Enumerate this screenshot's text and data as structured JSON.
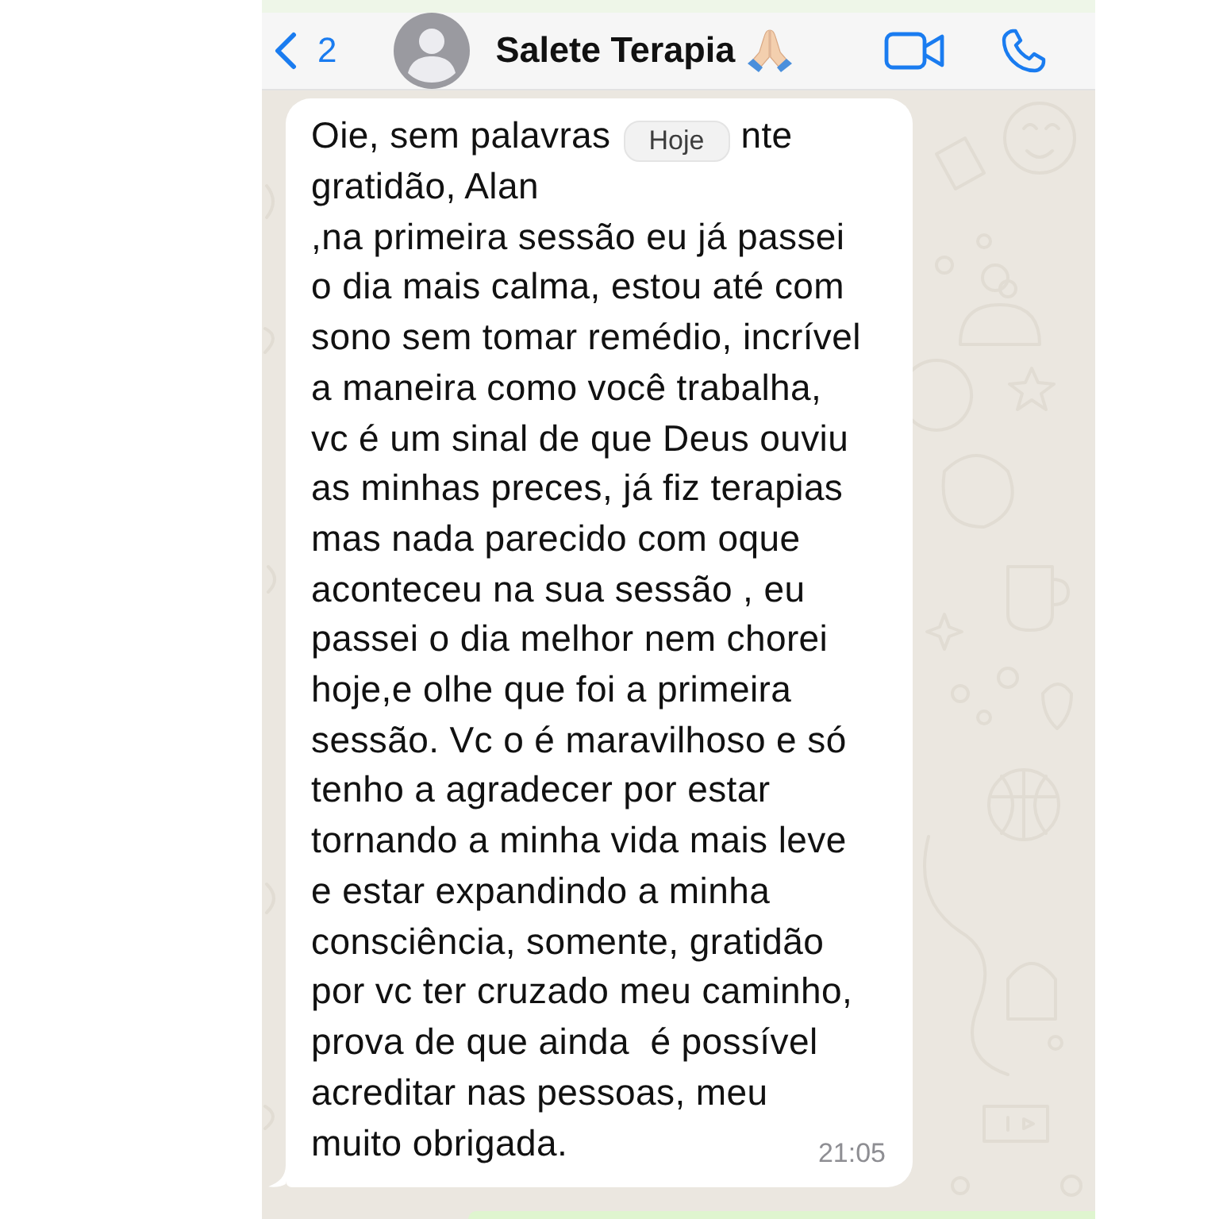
{
  "header": {
    "back_count": "2",
    "contact_name": "Salete Terapia"
  },
  "date_separator": {
    "label": "Hoje"
  },
  "message": {
    "text_before_badge": "Oie, sem palavras",
    "text_after_badge": "nte",
    "body": "gratidão, Alan\n,na primeira sessão eu já passei\no dia mais calma, estou até com\nsono sem tomar remédio, incrível\na maneira como você trabalha,\nvc é um sinal de que Deus ouviu\nas minhas preces, já fiz terapias\nmas nada parecido com oque\naconteceu na sua sessão , eu\npassei o dia melhor nem chorei\nhoje,e olhe que foi a primeira\nsessão. Vc o é maravilhoso e só\ntenho a agradecer por estar\ntornando a minha vida mais leve\ne estar expandindo a minha\nconsciência, somente, gratidão\npor vc ter cruzado meu caminho,\nprova de que ainda  é possível\nacreditar nas pessoas, meu",
    "last_line": "muito obrigada.",
    "time": "21:05"
  }
}
